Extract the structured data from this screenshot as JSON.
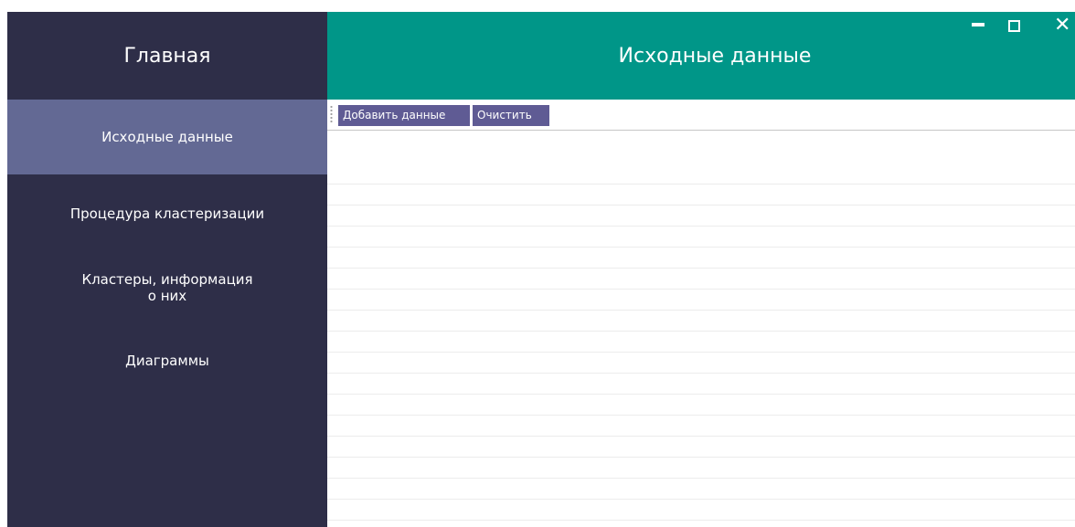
{
  "sidebar": {
    "title": "Главная",
    "items": [
      {
        "label": "Исходные данные",
        "active": true
      },
      {
        "label": "Процедура кластеризации",
        "active": false
      },
      {
        "label": "Кластеры, информация\nо них",
        "active": false
      },
      {
        "label": "Диаграммы",
        "active": false
      }
    ]
  },
  "header": {
    "title": "Исходные данные"
  },
  "toolbar": {
    "add_label": "Добавить данные",
    "clear_label": "Очистить"
  },
  "colors": {
    "sidebar_bg": "#2e2e48",
    "active_item_bg": "#636994",
    "header_bg": "#009688",
    "button_bg": "#5f5b94"
  },
  "icons": {
    "minimize": "minimize-icon",
    "maximize": "maximize-icon",
    "close": "close-icon",
    "grip": "toolbar-grip-icon"
  }
}
